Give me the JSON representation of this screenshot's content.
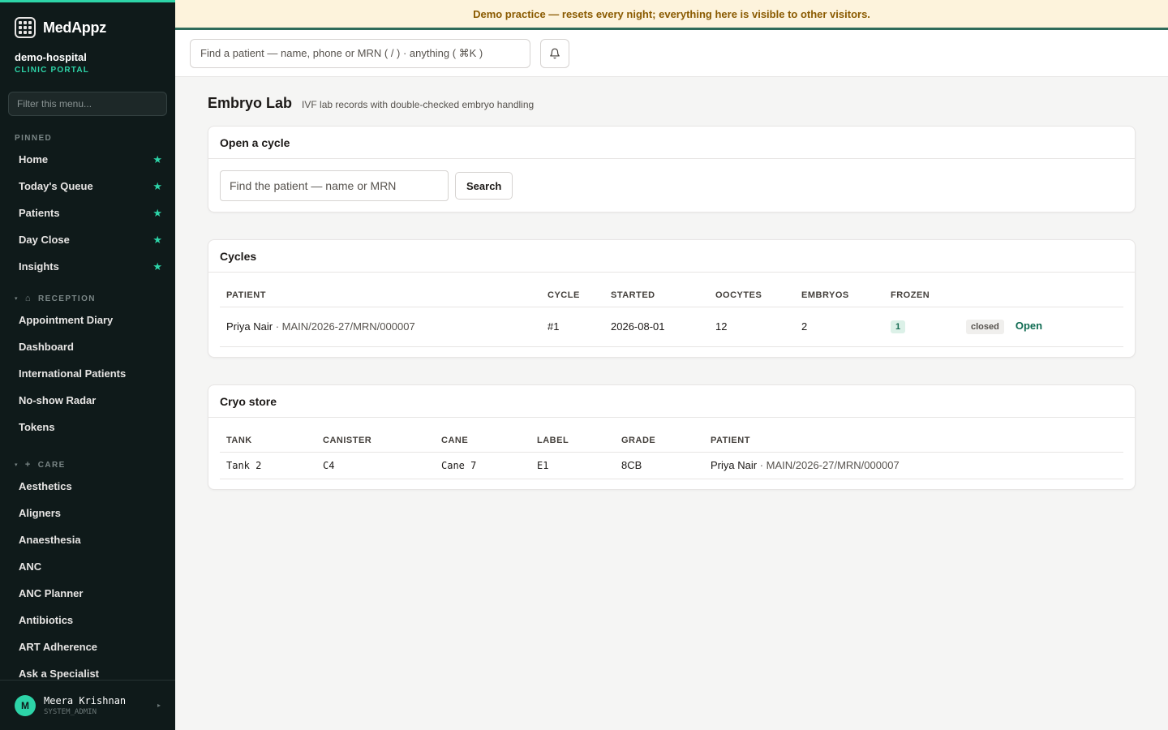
{
  "brand": {
    "name": "MedAppz"
  },
  "org": {
    "name": "demo-hospital",
    "subtitle": "CLINIC PORTAL"
  },
  "sidebar": {
    "filter_placeholder": "Filter this menu...",
    "pinned_label": "PINNED",
    "pinned": [
      {
        "label": "Home"
      },
      {
        "label": "Today's Queue"
      },
      {
        "label": "Patients"
      },
      {
        "label": "Day Close"
      },
      {
        "label": "Insights"
      }
    ],
    "reception_label": "RECEPTION",
    "reception": [
      {
        "label": "Appointment Diary"
      },
      {
        "label": "Dashboard"
      },
      {
        "label": "International Patients"
      },
      {
        "label": "No-show Radar"
      },
      {
        "label": "Tokens"
      }
    ],
    "care_label": "CARE",
    "care": [
      {
        "label": "Aesthetics"
      },
      {
        "label": "Aligners"
      },
      {
        "label": "Anaesthesia"
      },
      {
        "label": "ANC"
      },
      {
        "label": "ANC Planner"
      },
      {
        "label": "Antibiotics"
      },
      {
        "label": "ART Adherence"
      },
      {
        "label": "Ask a Specialist"
      }
    ]
  },
  "user": {
    "initial": "M",
    "name": "Meera Krishnan",
    "role": "SYSTEM_ADMIN"
  },
  "banner": {
    "text": "Demo practice — resets every night; everything here is visible to other visitors."
  },
  "topbar": {
    "search_placeholder": "Find a patient — name, phone or MRN ( / ) · anything ( ⌘K )"
  },
  "page": {
    "title": "Embryo Lab",
    "subtitle": "IVF lab records with double-checked embryo handling"
  },
  "open_cycle": {
    "title": "Open a cycle",
    "input_placeholder": "Find the patient — name or MRN",
    "search_label": "Search"
  },
  "cycles": {
    "title": "Cycles",
    "columns": [
      "PATIENT",
      "CYCLE",
      "STARTED",
      "OOCYTES",
      "EMBRYOS",
      "FROZEN"
    ],
    "rows": [
      {
        "patient": "Priya Nair",
        "mrn": "· MAIN/2026-27/MRN/000007",
        "cycle": "#1",
        "started": "2026-08-01",
        "oocytes": "12",
        "embryos": "2",
        "frozen": "1",
        "status": "closed",
        "action": "Open"
      }
    ]
  },
  "cryo": {
    "title": "Cryo store",
    "columns": [
      "TANK",
      "CANISTER",
      "CANE",
      "LABEL",
      "GRADE",
      "PATIENT"
    ],
    "rows": [
      {
        "tank": "Tank 2",
        "canister": "C4",
        "cane": "Cane 7",
        "label": "E1",
        "grade": "8CB",
        "patient": "Priya Nair",
        "mrn": "· MAIN/2026-27/MRN/000007"
      }
    ]
  },
  "colors": {
    "accent": "#2dd4a8",
    "sidebar_bg": "#0f1a1a",
    "banner_bg": "#fdf3dc",
    "banner_text": "#8a5a00",
    "link": "#0f6b52"
  }
}
